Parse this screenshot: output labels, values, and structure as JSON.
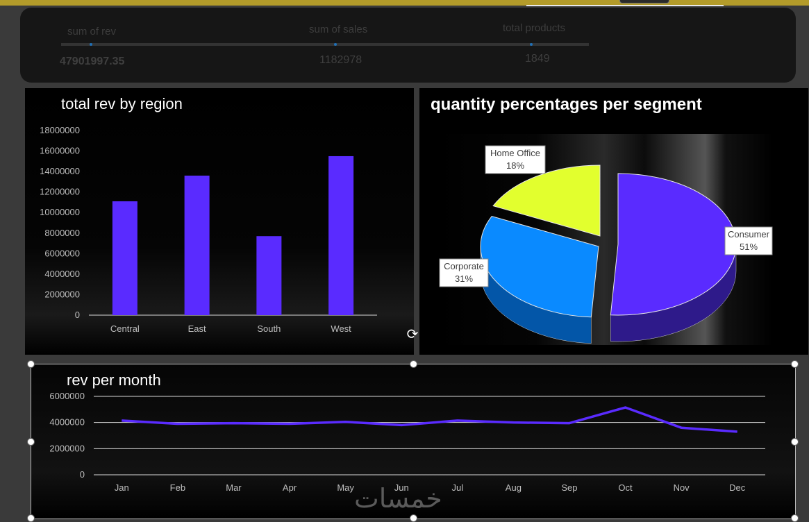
{
  "kpis": [
    {
      "label": "sum of rev",
      "value": "47901997.35"
    },
    {
      "label": "sum of  sales",
      "value": "1182978"
    },
    {
      "label": "total products",
      "value": "1849"
    }
  ],
  "chart_data": [
    {
      "type": "bar",
      "title": "total  rev by region",
      "categories": [
        "Central",
        "East",
        "South",
        "West"
      ],
      "values": [
        11100000,
        13600000,
        7700000,
        15500000
      ],
      "ylim": [
        0,
        18000000
      ],
      "yticks": [
        "0",
        "2000000",
        "4000000",
        "6000000",
        "8000000",
        "10000000",
        "12000000",
        "14000000",
        "16000000",
        "18000000"
      ],
      "color": "#5a2bff",
      "grid": false
    },
    {
      "type": "pie",
      "title": "quantity  percentages  per  segment",
      "slices": [
        {
          "label": "Consumer",
          "value": 51,
          "pct_label": "51%",
          "color": "#5a2bff"
        },
        {
          "label": "Corporate",
          "value": 31,
          "pct_label": "31%",
          "color": "#0a8aff"
        },
        {
          "label": "Home Office",
          "value": 18,
          "pct_label": "18%",
          "color": "#e2ff2e"
        }
      ]
    },
    {
      "type": "line",
      "title": "rev per month",
      "categories": [
        "Jan",
        "Feb",
        "Mar",
        "Apr",
        "May",
        "Jun",
        "Jul",
        "Aug",
        "Sep",
        "Oct",
        "Nov",
        "Dec"
      ],
      "values": [
        4150000,
        3900000,
        3950000,
        3900000,
        4050000,
        3800000,
        4150000,
        4000000,
        3950000,
        5150000,
        3600000,
        3300000
      ],
      "ylim": [
        0,
        6000000
      ],
      "yticks": [
        "0",
        "2000000",
        "4000000",
        "6000000"
      ],
      "color": "#5a2bff",
      "grid": true
    }
  ],
  "watermark": "خمسات"
}
